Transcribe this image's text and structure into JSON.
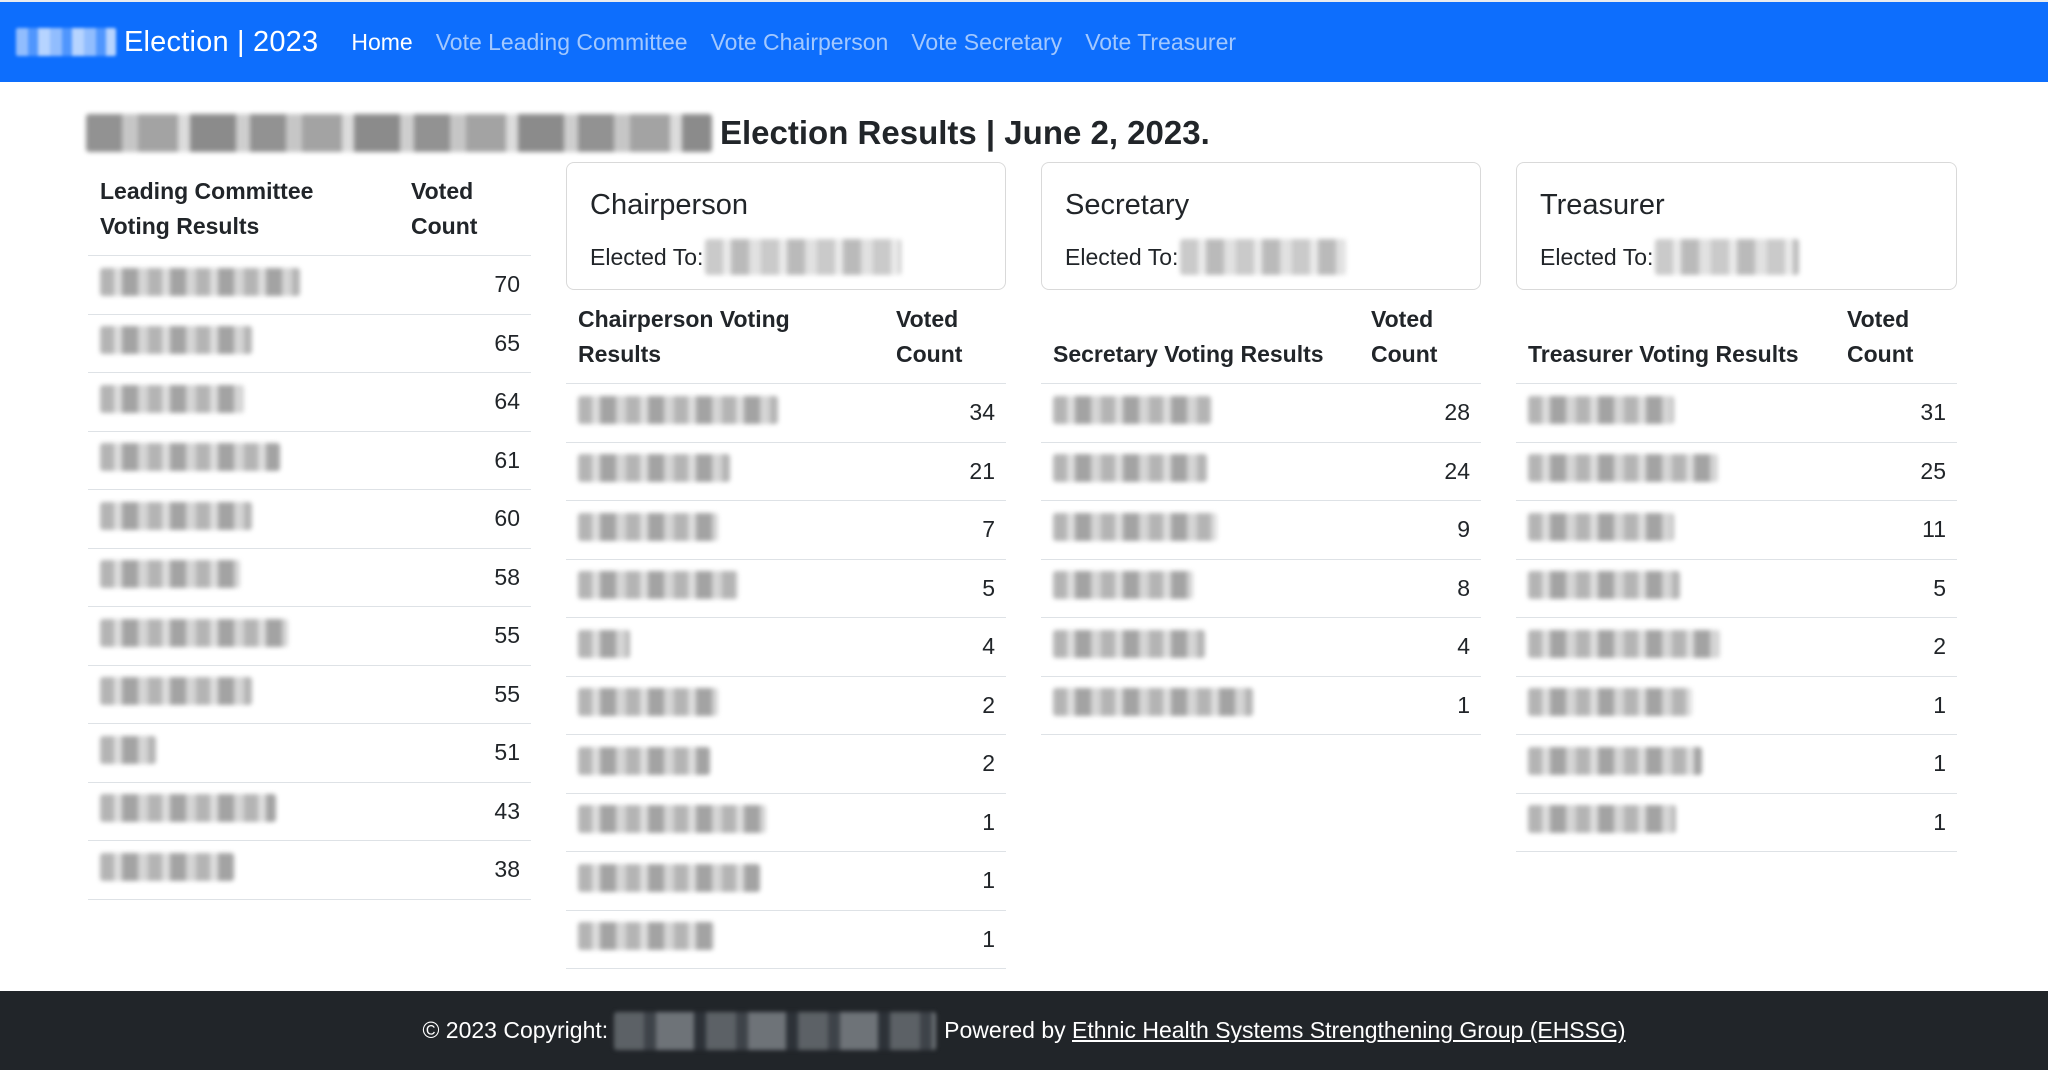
{
  "navbar": {
    "brand": "Election | 2023",
    "links": [
      "Home",
      "Vote Leading Committee",
      "Vote Chairperson",
      "Vote Secretary",
      "Vote Treasurer"
    ]
  },
  "page": {
    "title": "Election Results | June 2, 2023."
  },
  "leading_committee": {
    "headers": [
      "Leading Committee Voting Results",
      "Voted Count"
    ],
    "counts": [
      "70",
      "65",
      "64",
      "61",
      "60",
      "58",
      "55",
      "55",
      "51",
      "43",
      "38"
    ]
  },
  "chairperson": {
    "card_title": "Chairperson",
    "card_label": "Elected To:",
    "headers": [
      "Chairperson Voting Results",
      "Voted Count"
    ],
    "counts": [
      "34",
      "21",
      "7",
      "5",
      "4",
      "2",
      "2",
      "1",
      "1",
      "1"
    ]
  },
  "secretary": {
    "card_title": "Secretary",
    "card_label": "Elected To:",
    "headers": [
      "Secretary Voting Results",
      "Voted Count"
    ],
    "counts": [
      "28",
      "24",
      "9",
      "8",
      "4",
      "1"
    ]
  },
  "treasurer": {
    "card_title": "Treasurer",
    "card_label": "Elected To:",
    "headers": [
      "Treasurer Voting Results",
      "Voted Count"
    ],
    "counts": [
      "31",
      "25",
      "11",
      "5",
      "2",
      "1",
      "1",
      "1"
    ]
  },
  "footer": {
    "copyright": "© 2023 Copyright:",
    "powered_by": "Powered by",
    "link_text": "Ethnic Health Systems Strengthening Group (EHSSG)"
  }
}
